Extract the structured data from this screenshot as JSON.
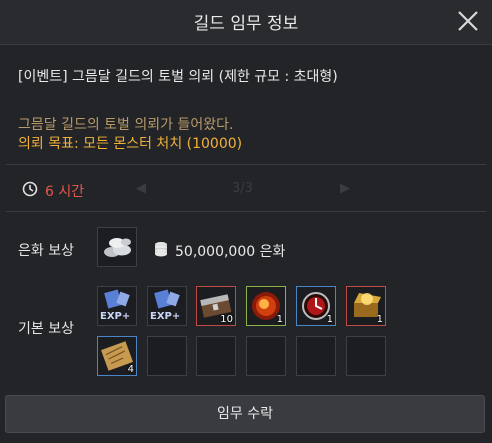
{
  "window": {
    "title": "길드 임무 정보"
  },
  "quest": {
    "name": "[이벤트] 그믐달 길드의 토벌 의뢰 (제한 규모 : 초대형)",
    "description": "그믐달 길드의 토벌 의뢰가 들어왔다.",
    "goal": "의뢰 목표: 모든 몬스터 처치 (10000)",
    "time_limit": "6 시간"
  },
  "background_ghost": {
    "page": "3/3"
  },
  "rewards": {
    "currency_label": "은화 보상",
    "currency_amount": "50,000,000 은화",
    "basic_label": "기본 보상",
    "items": [
      {
        "icon": "exp-scroll-icon",
        "count": ""
      },
      {
        "icon": "exp-scroll-icon",
        "count": ""
      },
      {
        "icon": "chest-icon",
        "count": "10"
      },
      {
        "icon": "fire-orb-icon",
        "count": "1"
      },
      {
        "icon": "red-orb-icon",
        "count": "1"
      },
      {
        "icon": "gold-chest-icon",
        "count": "1"
      },
      {
        "icon": "scroll-map-icon",
        "count": "4"
      }
    ],
    "exp_text": "EXP+"
  },
  "accept_button": {
    "label": "임무 수락"
  },
  "colors": {
    "goal": "#f2b23a",
    "time": "#e2584c",
    "desc": "#b89a6a"
  }
}
